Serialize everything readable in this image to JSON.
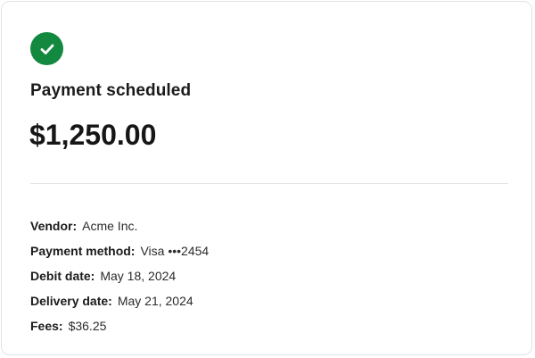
{
  "confirmation": {
    "icon": "check-circle-icon",
    "accent": "#12893f",
    "title": "Payment scheduled",
    "amount": "$1,250.00"
  },
  "details": [
    {
      "label": "Vendor:",
      "value": "Acme Inc."
    },
    {
      "label": "Payment method:",
      "value": "Visa •••2454"
    },
    {
      "label": "Debit date:",
      "value": "May 18, 2024"
    },
    {
      "label": "Delivery date:",
      "value": "May 21, 2024"
    },
    {
      "label": "Fees:",
      "value": "$36.25"
    }
  ]
}
